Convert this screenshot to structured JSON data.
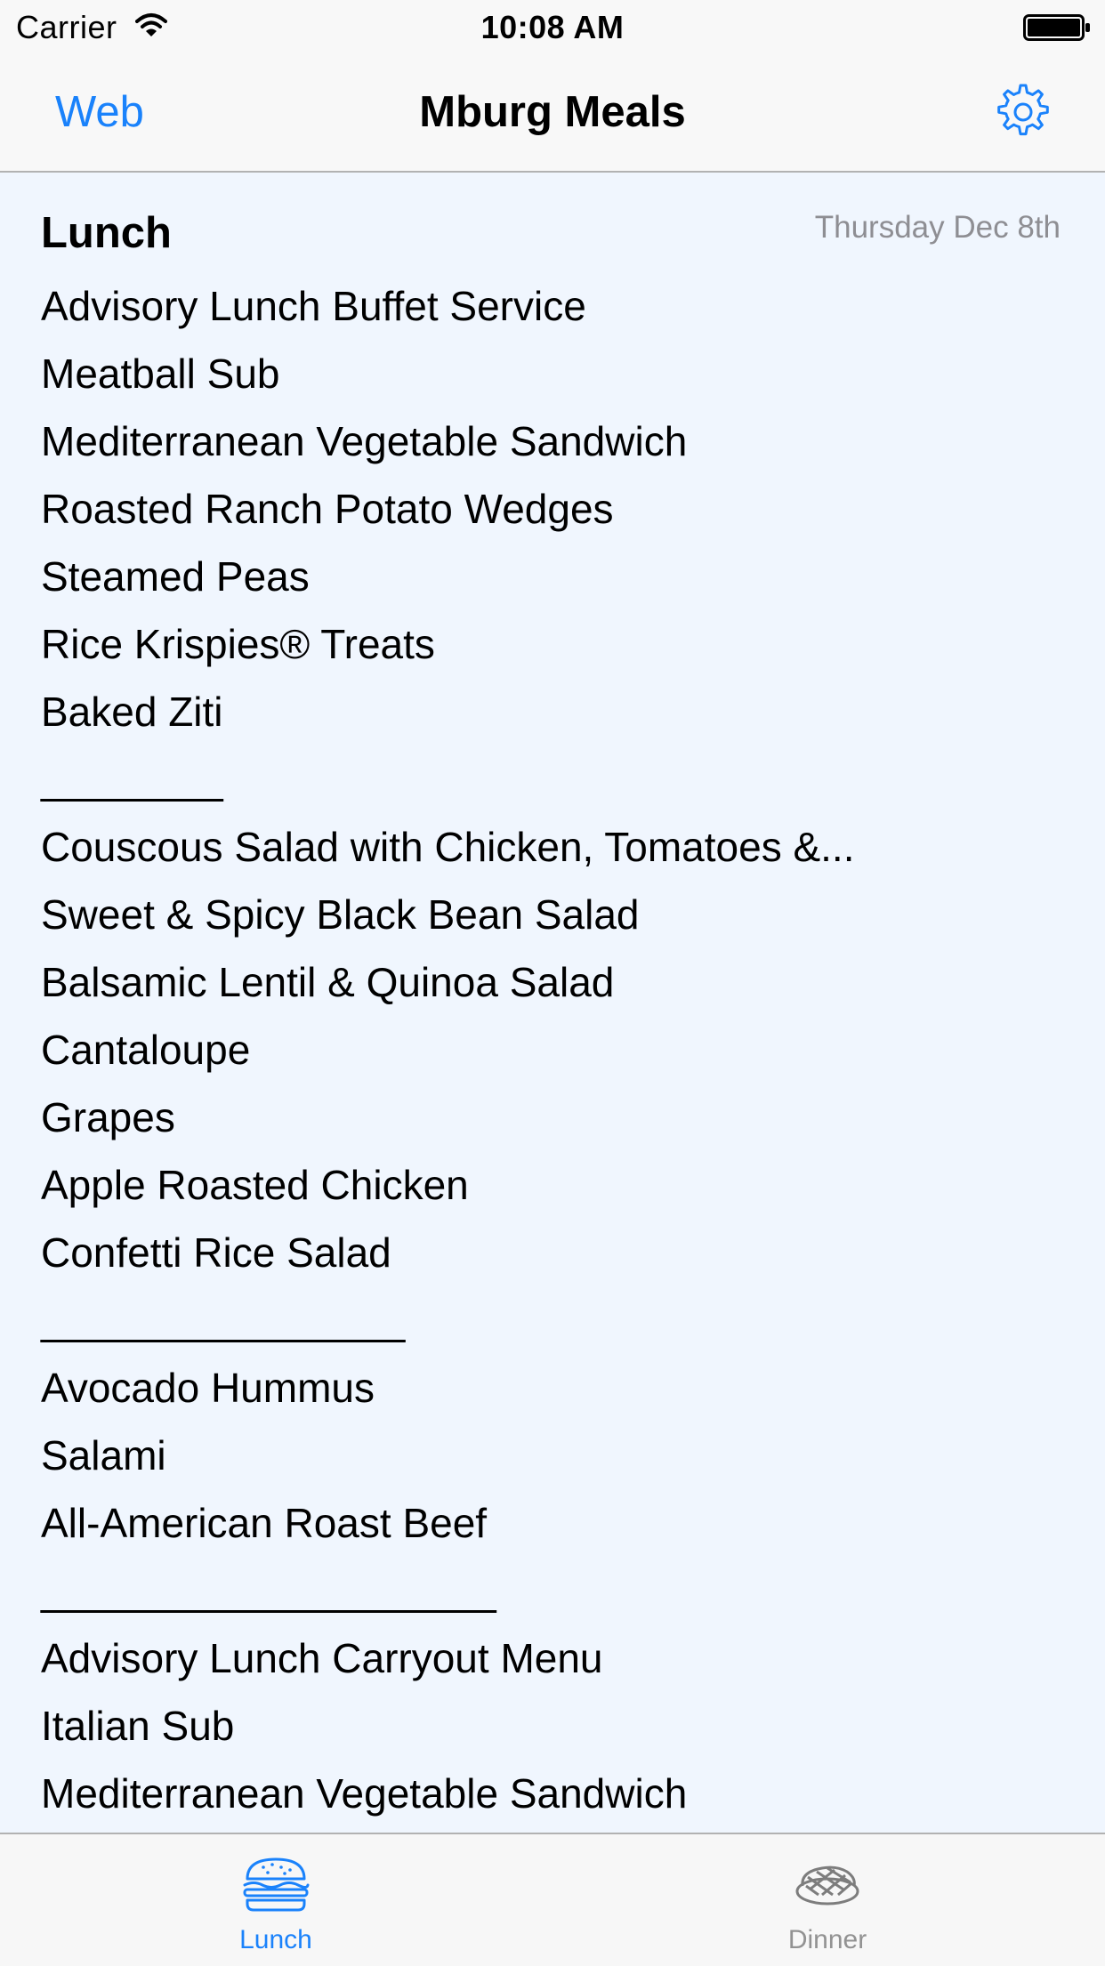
{
  "status_bar": {
    "carrier": "Carrier",
    "time": "10:08 AM",
    "wifi_icon": "wifi-icon",
    "battery_icon": "battery-full-icon"
  },
  "nav_bar": {
    "left_button": "Web",
    "title": "Mburg Meals",
    "right_icon": "gear-icon"
  },
  "content": {
    "section_title": "Lunch",
    "date": "Thursday Dec 8th",
    "items": [
      "Advisory Lunch Buffet Service",
      "Meatball Sub",
      "Mediterranean Vegetable Sandwich",
      "Roasted Ranch Potato Wedges",
      "Steamed Peas",
      "Rice Krispies® Treats",
      "Baked Ziti",
      "________",
      "Couscous Salad with Chicken, Tomatoes &...",
      "Sweet & Spicy Black Bean Salad",
      "Balsamic Lentil & Quinoa Salad",
      "Cantaloupe",
      "Grapes",
      "Apple Roasted Chicken",
      "Confetti Rice Salad",
      "________________",
      "Avocado Hummus",
      "Salami",
      "All-American Roast Beef",
      "____________________",
      "Advisory Lunch Carryout Menu",
      "Italian Sub",
      "Mediterranean Vegetable Sandwich"
    ]
  },
  "tab_bar": {
    "tabs": [
      {
        "label": "Lunch",
        "icon": "burger-icon",
        "selected": true
      },
      {
        "label": "Dinner",
        "icon": "steak-icon",
        "selected": false
      }
    ]
  },
  "colors": {
    "accent": "#1a82fb",
    "background": "#f0f6fe",
    "inactive": "#929292"
  }
}
